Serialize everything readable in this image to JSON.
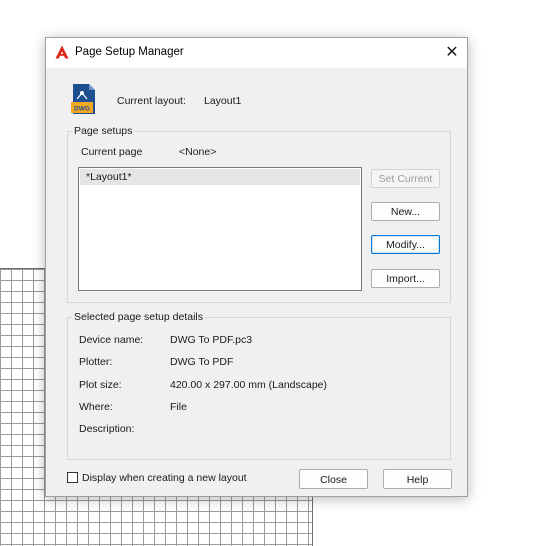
{
  "dialog": {
    "title": "Page Setup Manager",
    "app_icon": "autocad-logo-icon",
    "close_icon": "close-icon",
    "current_layout_label": "Current layout:",
    "current_layout_value": "Layout1",
    "file_icon": "dwg-file-icon",
    "file_icon_text": "DWG"
  },
  "page_setups": {
    "legend": "Page setups",
    "current_page_label": "Current page",
    "current_page_value": "<None>",
    "list": [
      "*Layout1*"
    ],
    "buttons": {
      "set_current": "Set Current",
      "new": "New...",
      "modify": "Modify...",
      "import": "Import..."
    }
  },
  "details": {
    "legend": "Selected page setup details",
    "rows": [
      {
        "label": "Device name:",
        "value": "DWG To PDF.pc3"
      },
      {
        "label": "Plotter:",
        "value": "DWG To PDF"
      },
      {
        "label": "Plot size:",
        "value": "420.00 x 297.00 mm (Landscape)"
      },
      {
        "label": "Where:",
        "value": "File"
      },
      {
        "label": "Description:",
        "value": ""
      }
    ]
  },
  "footer": {
    "checkbox_label": "Display when creating a new layout",
    "checkbox_checked": false,
    "close": "Close",
    "help": "Help"
  },
  "colors": {
    "autocad_red": "#e2231a",
    "dwg_blue": "#1d4f91",
    "dwg_orange": "#f5a623",
    "focus_blue": "#0078d7"
  }
}
